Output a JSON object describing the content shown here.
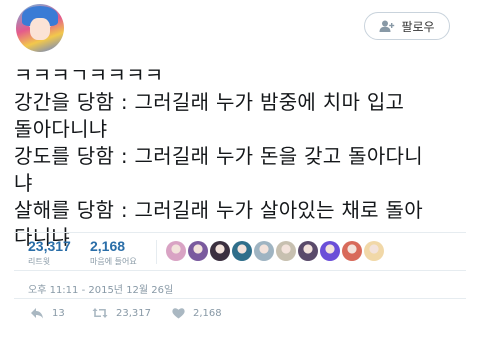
{
  "header": {
    "follow_label": "팔로우"
  },
  "tweet": {
    "lines": [
      "ㅋㅋㅋㄱㅋㅋㅋㅋ",
      "강간을 당함 : 그러길래 누가 밤중에 치마 입고",
      "돌아다니냐",
      "강도를 당함 : 그러길래 누가 돈을 갖고 돌아다니",
      "냐",
      "살해를 당함 : 그러길래 누가 살아있는 채로 돌아",
      "다니냐"
    ]
  },
  "stats": {
    "retweets": {
      "count": "23,317",
      "label": "리트윗"
    },
    "likes": {
      "count": "2,168",
      "label": "마음에 들어요"
    }
  },
  "likers": [
    {
      "color": "#d9a3c4"
    },
    {
      "color": "#7a5a9e"
    },
    {
      "color": "#3b3040"
    },
    {
      "color": "#2f6e8a"
    },
    {
      "color": "#9fb4c2"
    },
    {
      "color": "#c7c0b0"
    },
    {
      "color": "#5a4a6a"
    },
    {
      "color": "#6b4fd8"
    },
    {
      "color": "#d86a5a"
    },
    {
      "color": "#f1d8a8"
    }
  ],
  "timestamp": "오후 11:11 - 2015년 12월 26일",
  "actions": {
    "reply_count": "13",
    "retweet_count": "23,317",
    "like_count": "2,168"
  }
}
